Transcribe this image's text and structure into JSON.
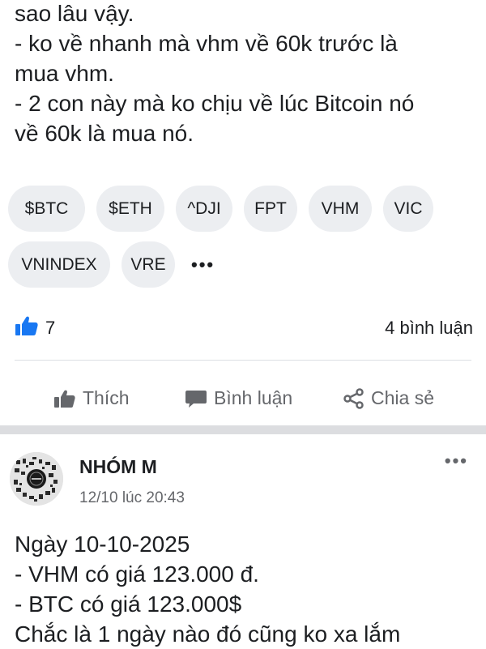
{
  "post1": {
    "text_lines": [
      "sao lâu vậy.",
      "-  ko về nhanh mà vhm về 60k trước là",
      "mua vhm.",
      "- 2 con này mà ko chịu về lúc Bitcoin nó",
      "về 60k là mua nó."
    ],
    "tags_row1": [
      "$BTC",
      "$ETH",
      "^DJI",
      "FPT",
      "VHM",
      "VIC"
    ],
    "tags_row2": [
      "VNINDEX",
      "VRE"
    ],
    "more_tags": "•••",
    "like_icon": "thumbs-up-icon",
    "like_count": "7",
    "comment_count": "4 bình luận",
    "actions": {
      "like": "Thích",
      "comment": "Bình luận",
      "share": "Chia sẻ"
    },
    "colors": {
      "reaction_blue": "#1877f2",
      "action_gray": "#65676b",
      "chip_bg": "#eceef1"
    }
  },
  "post2": {
    "author": "NHÓM M",
    "timestamp": "12/10 lúc 20:43",
    "menu": "•••",
    "text_lines": [
      "Ngày 10-10-2025",
      "- VHM có giá 123.000 đ.",
      "- BTC có giá 123.000$",
      "Chắc là 1 ngày nào đó cũng ko xa lắm"
    ]
  }
}
